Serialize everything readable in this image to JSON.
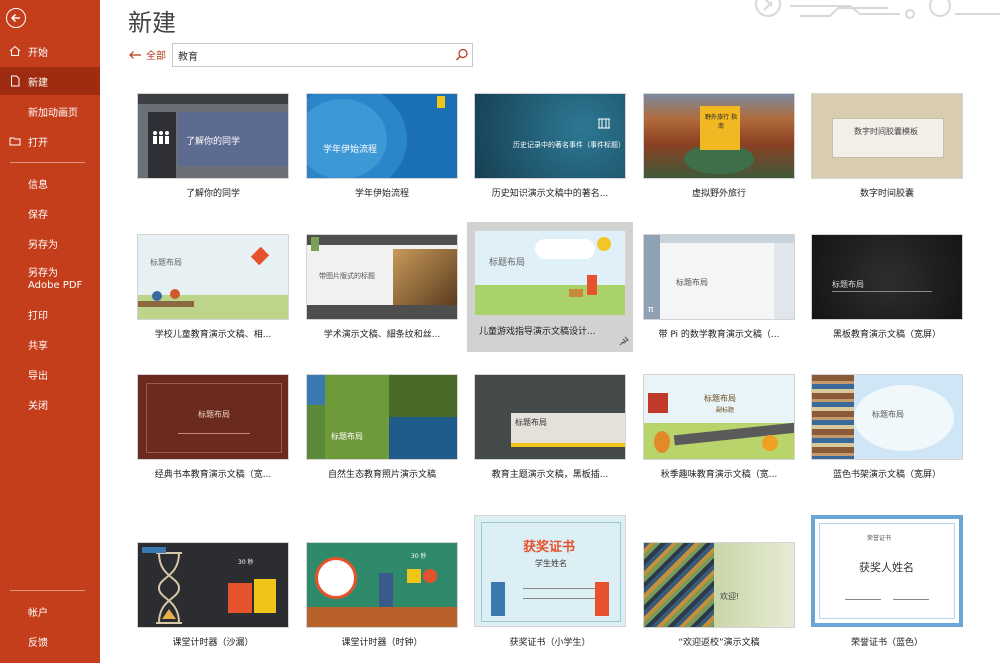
{
  "page": {
    "title": "新建"
  },
  "sidebar": {
    "items": [
      {
        "label": "开始"
      },
      {
        "label": "新建"
      },
      {
        "label": "新加动画页"
      },
      {
        "label": "打开"
      },
      {
        "label": "信息"
      },
      {
        "label": "保存"
      },
      {
        "label": "另存为"
      },
      {
        "label": "另存为 Adobe PDF"
      },
      {
        "label": "打印"
      },
      {
        "label": "共享"
      },
      {
        "label": "导出"
      },
      {
        "label": "关闭"
      },
      {
        "label": "帐户"
      },
      {
        "label": "反馈"
      }
    ]
  },
  "search": {
    "back_label": "全部",
    "value": "教育"
  },
  "templates": [
    {
      "label": "了解你的同学",
      "thumb_title": "了解你的同学"
    },
    {
      "label": "学年伊始流程",
      "thumb_title": "学年伊始流程"
    },
    {
      "label": "历史知识演示文稿中的著名...",
      "thumb_title": "历史记录中的著名事件（事件标题）"
    },
    {
      "label": "虚拟野外旅行",
      "thumb_title": "野外旅行 指南"
    },
    {
      "label": "数字时间胶囊",
      "thumb_title": "数字时间胶囊模板"
    },
    {
      "label": "学校儿童教育演示文稿、相...",
      "thumb_title": "标题布局"
    },
    {
      "label": "学术演示文稿、細条纹和丝...",
      "thumb_title": "带图片版式的标题"
    },
    {
      "label": "儿童游戏指导演示文稿设计...",
      "thumb_title": "标题布局"
    },
    {
      "label": "带 Pi 的数学教育演示文稿（...",
      "thumb_title": "标题布局",
      "pi": "π"
    },
    {
      "label": "黑板教育演示文稿（宽屏）",
      "thumb_title": "标题布局"
    },
    {
      "label": "经典书本教育演示文稿（宽...",
      "thumb_title": "标题布局"
    },
    {
      "label": "自然生态教育照片演示文稿",
      "thumb_title": "标题布局"
    },
    {
      "label": "教育主题演示文稿，黑板插...",
      "thumb_title": "标题布局"
    },
    {
      "label": "秋季趣味教育演示文稿（宽...",
      "thumb_title": "标题布局",
      "thumb_sub": "副标题"
    },
    {
      "label": "蓝色书架演示文稿（宽屏）",
      "thumb_title": "标题布局"
    },
    {
      "label": "课堂计时器（沙漏）",
      "thumb_title": "",
      "thumb_sub": "30 秒"
    },
    {
      "label": "课堂计时器（时钟）",
      "thumb_title": "",
      "thumb_sub": "30 秒"
    },
    {
      "label": "获奖证书（小学生）",
      "thumb_title": "获奖证书",
      "thumb_sub": "学生姓名"
    },
    {
      "label": "“欢迎返校”演示文稿",
      "thumb_title": "欢迎!"
    },
    {
      "label": "荣誉证书（蓝色）",
      "thumb_title": "获奖人姓名",
      "thumb_sub": "荣誉证书"
    }
  ],
  "colors": {
    "accent": "#c43e1c",
    "active": "#9f2b10"
  }
}
